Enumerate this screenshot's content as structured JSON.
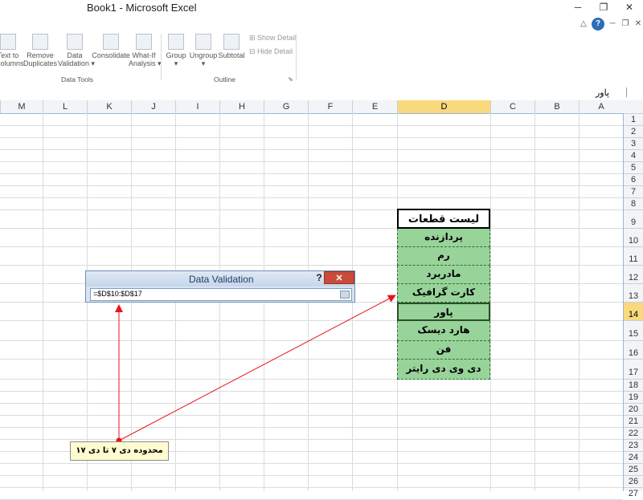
{
  "window": {
    "title": "Book1  -  Microsoft Excel"
  },
  "ribbon": {
    "buttons": [
      {
        "label": "Text to\nColumns",
        "icon": "text-to-columns-icon"
      },
      {
        "label": "Remove\nDuplicates",
        "icon": "remove-duplicates-icon"
      },
      {
        "label": "Data\nValidation ▾",
        "icon": "data-validation-icon"
      },
      {
        "label": "Consolidate",
        "icon": "consolidate-icon"
      },
      {
        "label": "What-If\nAnalysis ▾",
        "icon": "what-if-icon"
      },
      {
        "label": "Group\n▾",
        "icon": "group-icon"
      },
      {
        "label": "Ungroup\n▾",
        "icon": "ungroup-icon"
      },
      {
        "label": "Subtotal",
        "icon": "subtotal-icon"
      }
    ],
    "show_detail": "Show Detail",
    "hide_detail": "Hide Detail",
    "group_data_tools": "Data Tools",
    "group_outline": "Outline"
  },
  "formula_bar": {
    "name_value": "پاور"
  },
  "sheet": {
    "columns": [
      "M",
      "L",
      "K",
      "J",
      "I",
      "H",
      "G",
      "F",
      "E",
      "D",
      "C",
      "B",
      "A"
    ],
    "selected_column": "D",
    "rows": [
      "1",
      "2",
      "3",
      "4",
      "5",
      "6",
      "7",
      "8",
      "9",
      "10",
      "11",
      "12",
      "13",
      "14",
      "15",
      "16",
      "17",
      "18",
      "19",
      "20",
      "21",
      "22",
      "23",
      "24",
      "25",
      "26",
      "27"
    ],
    "selected_row": "14",
    "list_header": "لیست قطعات",
    "list_items": [
      "پردازنده",
      "رم",
      "مادربرد",
      "کارت گرافیک",
      "پاور",
      "هارد دیسک",
      "فن",
      "دی وی دی رایتر"
    ],
    "selected_item": "پاور"
  },
  "dialog": {
    "title": "Data Validation",
    "help": "?",
    "close": "✕",
    "input_value": "=$D$10:$D$17"
  },
  "note": {
    "text": "محدوده دی ۷ تا دی ۱۷"
  },
  "colors": {
    "selected_header": "#f9d97e",
    "list_fill": "#98d39a",
    "arrow": "#e8141b",
    "dialog_close": "#c94b3b",
    "note_fill": "#fffccf"
  }
}
